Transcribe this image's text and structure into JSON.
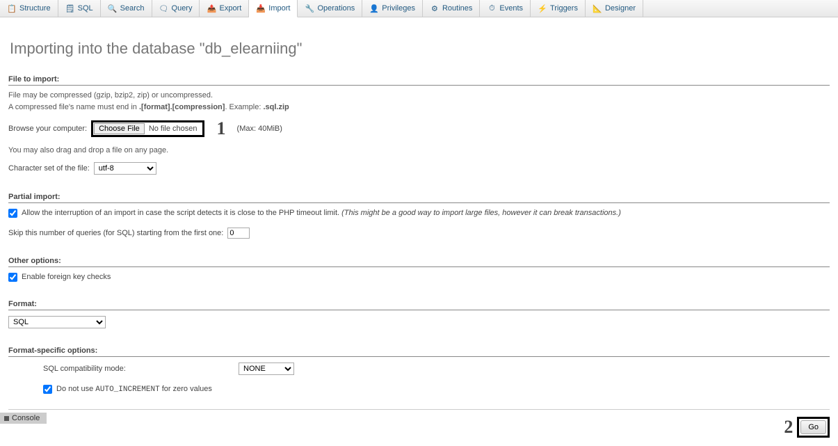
{
  "tabs": [
    {
      "label": "Structure",
      "icon": "📋"
    },
    {
      "label": "SQL",
      "icon": "🗒"
    },
    {
      "label": "Search",
      "icon": "🔍"
    },
    {
      "label": "Query",
      "icon": "🗨"
    },
    {
      "label": "Export",
      "icon": "📤"
    },
    {
      "label": "Import",
      "icon": "📥"
    },
    {
      "label": "Operations",
      "icon": "🔧"
    },
    {
      "label": "Privileges",
      "icon": "👤"
    },
    {
      "label": "Routines",
      "icon": "⚙"
    },
    {
      "label": "Events",
      "icon": "⏱"
    },
    {
      "label": "Triggers",
      "icon": "⚡"
    },
    {
      "label": "Designer",
      "icon": "📐"
    }
  ],
  "active_tab": "Import",
  "page_title": "Importing into the database \"db_elearniing\"",
  "file_import": {
    "section": "File to import:",
    "help1": "File may be compressed (gzip, bzip2, zip) or uncompressed.",
    "help2a": "A compressed file's name must end in ",
    "help2b": ".[format].[compression]",
    "help2c": ". Example: ",
    "help2d": ".sql.zip",
    "browse_label": "Browse your computer:",
    "choose_btn": "Choose File",
    "file_status": "No file chosen",
    "max_size": "(Max: 40MiB)",
    "drag_help": "You may also drag and drop a file on any page.",
    "charset_label": "Character set of the file:",
    "charset_value": "utf-8"
  },
  "partial_import": {
    "section": "Partial import:",
    "allow_interrupt_label": "Allow the interruption of an import in case the script detects it is close to the PHP timeout limit. ",
    "allow_interrupt_italic": "(This might be a good way to import large files, however it can break transactions.)",
    "allow_interrupt_checked": true,
    "skip_label": "Skip this number of queries (for SQL) starting from the first one:",
    "skip_value": "0"
  },
  "other_options": {
    "section": "Other options:",
    "fk_label": "Enable foreign key checks",
    "fk_checked": true
  },
  "format": {
    "section": "Format:",
    "value": "SQL"
  },
  "format_specific": {
    "section": "Format-specific options:",
    "compat_label": "SQL compatibility mode:",
    "compat_value": "NONE",
    "noauto_label_a": "Do not use ",
    "noauto_code": "AUTO_INCREMENT",
    "noauto_label_b": " for zero values",
    "noauto_checked": true
  },
  "go_label": "Go",
  "console_label": "Console",
  "annotations": {
    "one": "1",
    "two": "2"
  }
}
